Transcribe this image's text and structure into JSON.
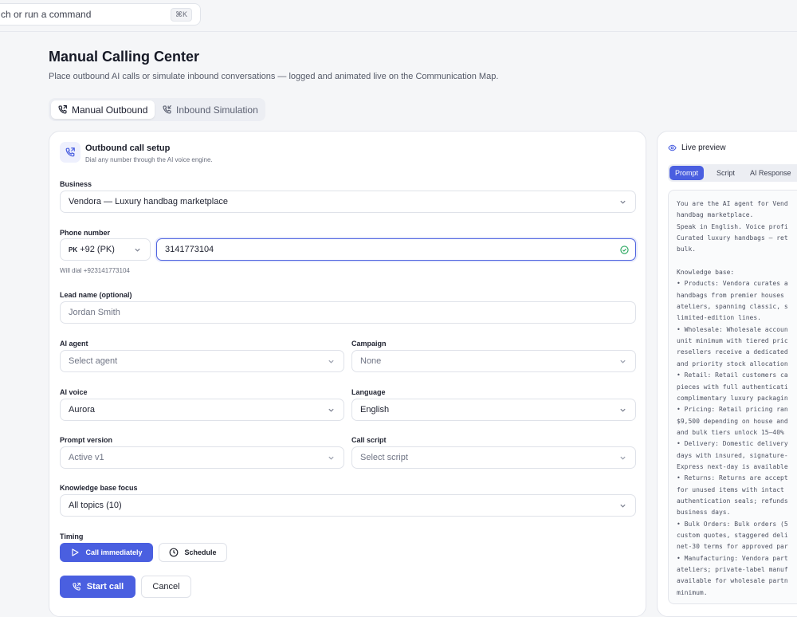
{
  "topbar": {
    "search_text": "ch or run a command",
    "shortcut": "⌘K"
  },
  "header": {
    "title": "Manual Calling Center",
    "subtitle": "Place outbound AI calls or simulate inbound conversations — logged and animated live on the Communication Map."
  },
  "mode_tabs": [
    {
      "label": "Manual Outbound",
      "active": true,
      "icon": "phone-outgoing-icon"
    },
    {
      "label": "Inbound Simulation",
      "active": false,
      "icon": "phone-incoming-icon"
    }
  ],
  "card": {
    "title": "Outbound call setup",
    "subtitle": "Dial any number through the AI voice engine.",
    "icon": "phone-outgoing-icon"
  },
  "form": {
    "business": {
      "label": "Business",
      "value": "Vendora — Luxury handbag marketplace"
    },
    "phone": {
      "label": "Phone number",
      "country_code": "PK",
      "country_value": "+92 (PK)",
      "number": "3141773104",
      "hint": "Will dial +923141773104"
    },
    "lead_name": {
      "label": "Lead name (optional)",
      "placeholder": "Jordan Smith"
    },
    "ai_agent": {
      "label": "AI agent",
      "placeholder": "Select agent"
    },
    "campaign": {
      "label": "Campaign",
      "value": "None"
    },
    "ai_voice": {
      "label": "AI voice",
      "value": "Aurora"
    },
    "language": {
      "label": "Language",
      "value": "English"
    },
    "prompt_version": {
      "label": "Prompt version",
      "value": "Active v1"
    },
    "call_script": {
      "label": "Call script",
      "placeholder": "Select script"
    },
    "knowledge_base": {
      "label": "Knowledge base focus",
      "value": "All topics (10)"
    },
    "timing": {
      "label": "Timing",
      "call_now": "Call immediately",
      "schedule": "Schedule"
    }
  },
  "actions": {
    "start": "Start call",
    "cancel": "Cancel"
  },
  "preview": {
    "title": "Live preview",
    "tabs": [
      {
        "label": "Prompt",
        "active": true
      },
      {
        "label": "Script",
        "active": false
      },
      {
        "label": "AI Response",
        "active": false
      }
    ],
    "lines": [
      "You are the AI agent for Vend",
      "handbag marketplace.",
      "Speak in English. Voice profi",
      "Curated luxury handbags — ret",
      "bulk.",
      "",
      "Knowledge base:",
      "• Products: Vendora curates a",
      "handbags from premier houses",
      "ateliers, spanning classic, s",
      "limited-edition lines.",
      "• Wholesale: Wholesale accoun",
      "unit minimum with tiered pric",
      "resellers receive a dedicated",
      "and priority stock allocation",
      "• Retail: Retail customers ca",
      "pieces with full authenticati",
      "complimentary luxury packagin",
      "• Pricing: Retail pricing ran",
      "$9,500 depending on house and",
      "and bulk tiers unlock 15–40%",
      "• Delivery: Domestic delivery",
      "days with insured, signature-",
      "Express next-day is available",
      "• Returns: Returns are accept",
      "for unused items with intact",
      "authentication seals; refunds",
      "business days.",
      "• Bulk Orders: Bulk orders (5",
      "custom quotes, staggered deli",
      "net-30 terms for approved par",
      "• Manufacturing: Vendora part",
      "ateliers; private-label manuf",
      "available for wholesale partn",
      "minimum."
    ]
  },
  "colors": {
    "accent": "#4a5fe0",
    "success": "#22a45a",
    "border": "#dfe2e9"
  }
}
